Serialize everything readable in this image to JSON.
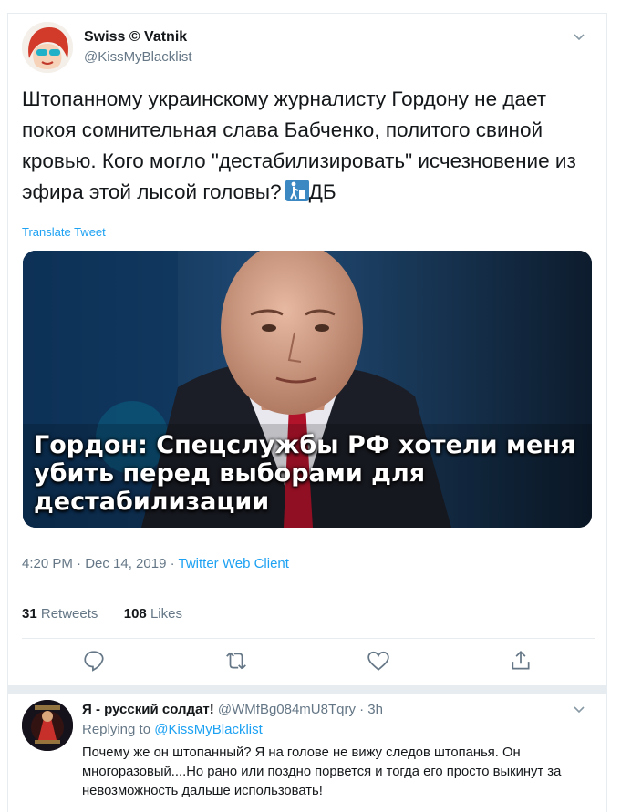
{
  "tweet": {
    "author_name": "Swiss © Vatnik",
    "author_handle": "@KissMyBlacklist",
    "text": "Штопанному украинскому журналисту Гордону не дает покоя сомнительная слава Бабченко, политого свиной кровью. Кого могло \"дестабилизировать\" исчезновение из эфира этой лысой головы?",
    "text_suffix": "ДБ",
    "emoji": "put-litter-in-its-place-emoji",
    "translate_label": "Translate Tweet",
    "image_caption": "Гордон: Спецслужбы РФ хотели меня убить перед выборами для дестабилизации",
    "timestamp": "4:20 PM · Dec 14, 2019 ·",
    "client": "Twitter Web Client",
    "retweets_count": "31",
    "retweets_label": "Retweets",
    "likes_count": "108",
    "likes_label": "Likes",
    "action_icons": [
      "reply-icon",
      "retweet-icon",
      "like-icon",
      "share-icon"
    ]
  },
  "reply": {
    "author_name": "Я - русский солдат!",
    "author_handle": "@WMfBg084mU8Tqry · 3h",
    "replying_label": "Replying to",
    "replying_to": "@KissMyBlacklist",
    "text": "Почему же он штопанный? Я на голове не вижу следов штопанья. Он многоразовый....Но рано или поздно порвется и тогда его просто выкинут за невозможность дальше использовать!"
  },
  "colors": {
    "accent": "#1da1f2",
    "muted": "#657786",
    "text": "#14171a",
    "border": "#e6ecf0"
  }
}
